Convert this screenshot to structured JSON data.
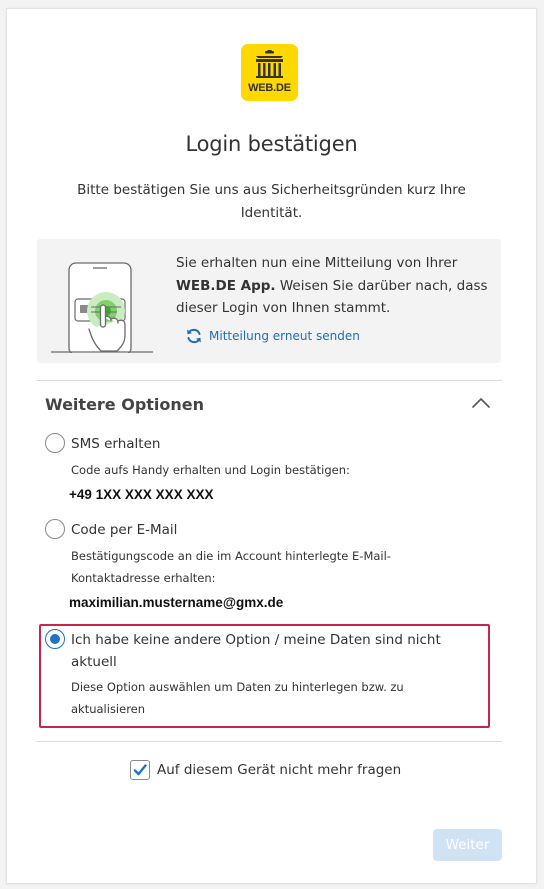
{
  "logo": {
    "text": "WEB.DE",
    "color": "#ffd800"
  },
  "title": "Login bestätigen",
  "subtitle": "Bitte bestätigen Sie uns aus Sicherheitsgründen kurz Ihre Identität.",
  "notice": {
    "text_before": "Sie erhalten nun eine Mitteilung von Ihrer ",
    "text_bold": "WEB.DE App.",
    "text_after": " Weisen Sie darüber nach, dass dieser Login von Ihnen stammt.",
    "resend_label": "Mitteilung erneut senden",
    "resend_icon": "refresh-icon"
  },
  "options": {
    "title": "Weitere Optionen",
    "expanded": true,
    "items": [
      {
        "label": "SMS erhalten",
        "description": "Code aufs Handy erhalten und Login bestätigen:",
        "value": "+49 1XX XXX XXX XXX",
        "selected": false
      },
      {
        "label": "Code per E-Mail",
        "description_line1": "Bestätigungscode an die im Account hinterlegte E-Mail-",
        "description_line2": "Kontaktadresse erhalten:",
        "value": "maximilian.mustername@gmx.de",
        "selected": false
      },
      {
        "label_line1": "Ich habe keine andere Option / meine Daten sind nicht",
        "label_line2": "aktuell",
        "description_line1": "Diese Option auswählen um Daten zu hinterlegen bzw. zu",
        "description_line2": "aktualisieren",
        "selected": true
      }
    ]
  },
  "remember": {
    "label": "Auf diesem Gerät nicht mehr fragen",
    "checked": true
  },
  "submit": {
    "label": "Weiter",
    "enabled": false
  },
  "colors": {
    "accent": "#1c73c7",
    "highlight_border": "#c8254a",
    "button_disabled": "#cfe3f5"
  }
}
